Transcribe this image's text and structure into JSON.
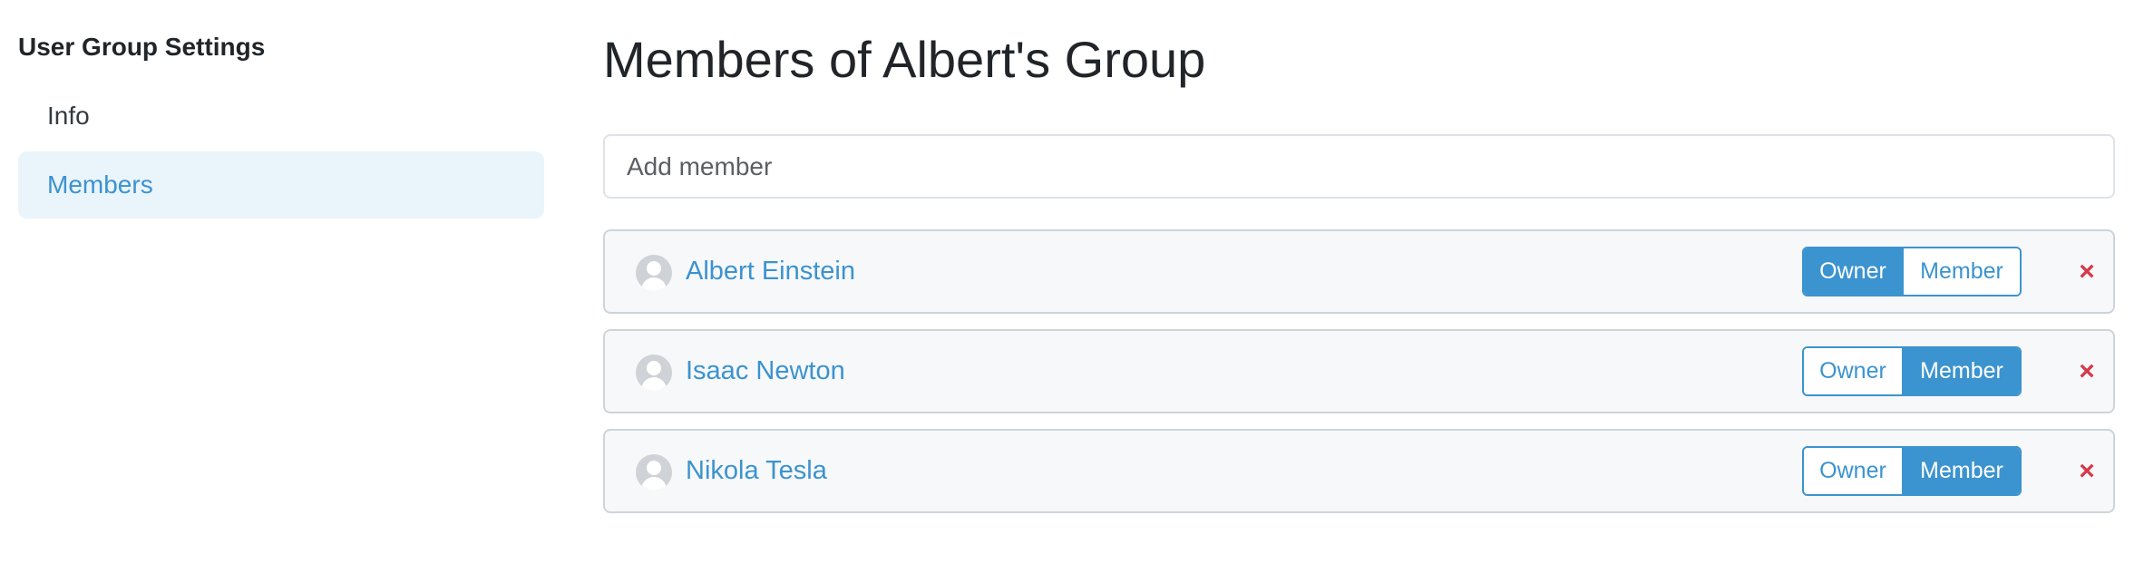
{
  "sidebar": {
    "title": "User Group Settings",
    "items": [
      {
        "label": "Info",
        "active": false
      },
      {
        "label": "Members",
        "active": true
      }
    ]
  },
  "main": {
    "title": "Members of Albert's Group",
    "add_member": {
      "placeholder": "Add member",
      "value": ""
    },
    "roles": {
      "owner_label": "Owner",
      "member_label": "Member"
    },
    "remove_icon": "×",
    "members": [
      {
        "name": "Albert Einstein",
        "role": "Owner"
      },
      {
        "name": "Isaac Newton",
        "role": "Member"
      },
      {
        "name": "Nikola Tesla",
        "role": "Member"
      }
    ]
  },
  "colors": {
    "accent": "#3b93cf",
    "active_nav_bg": "#eaf4fb",
    "remove": "#d63848",
    "row_bg": "#f7f8fa"
  }
}
